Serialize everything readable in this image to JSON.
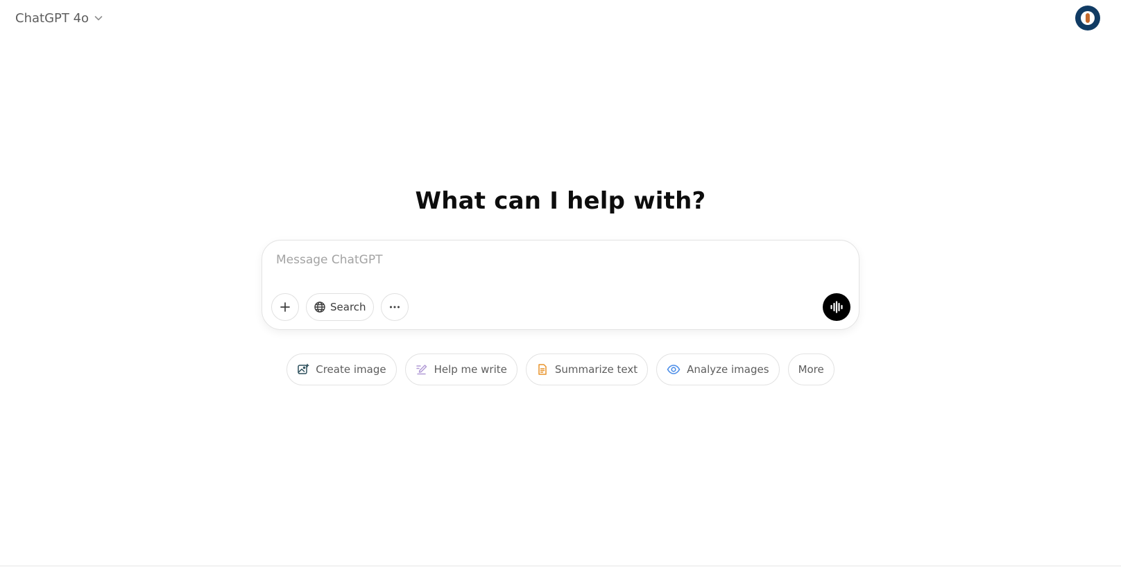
{
  "header": {
    "model_name": "ChatGPT 4o",
    "avatar_colors": {
      "ring": "#103b64",
      "accent": "#c4692c"
    }
  },
  "main": {
    "headline": "What can I help with?"
  },
  "composer": {
    "placeholder": "Message ChatGPT",
    "value": "",
    "tools": {
      "add_icon": "plus-icon",
      "search_label": "Search",
      "search_icon": "globe-icon",
      "more_icon": "ellipsis-icon"
    },
    "voice_icon": "voice-waveform-icon"
  },
  "suggestions": [
    {
      "label": "Create image",
      "icon": "image-icon",
      "icon_color": "#2c4f5b"
    },
    {
      "label": "Help me write",
      "icon": "pen-icon",
      "icon_color": "#b19ad6"
    },
    {
      "label": "Summarize text",
      "icon": "document-icon",
      "icon_color": "#e8942b"
    },
    {
      "label": "Analyze images",
      "icon": "eye-icon",
      "icon_color": "#4c8ee8"
    },
    {
      "label": "More",
      "icon": "",
      "icon_color": ""
    }
  ]
}
